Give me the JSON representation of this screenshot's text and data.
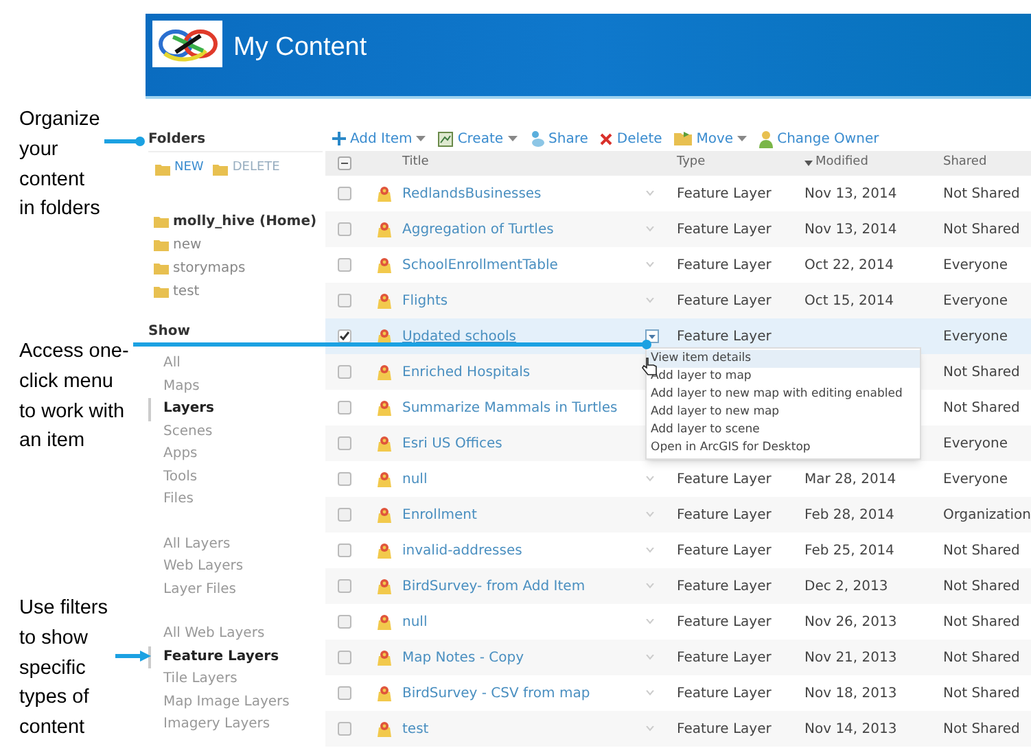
{
  "annotations": [
    {
      "text": "Organize your content in folders"
    },
    {
      "text": "Access one-click menu to work with an item"
    },
    {
      "text": "Use filters to show specific types of content"
    }
  ],
  "header": {
    "title": "My Content"
  },
  "sidebar": {
    "folders_heading": "Folders",
    "folder_actions": [
      {
        "label": "NEW",
        "disabled": false
      },
      {
        "label": "DELETE",
        "disabled": true
      }
    ],
    "folders": [
      {
        "label": "molly_hive (Home)",
        "selected": true
      },
      {
        "label": "new",
        "selected": false
      },
      {
        "label": "storymaps",
        "selected": false
      },
      {
        "label": "test",
        "selected": false
      }
    ],
    "show_heading": "Show",
    "filter_groups": [
      [
        {
          "label": "All",
          "selected": false
        },
        {
          "label": "Maps",
          "selected": false
        },
        {
          "label": "Layers",
          "selected": true
        },
        {
          "label": "Scenes",
          "selected": false
        },
        {
          "label": "Apps",
          "selected": false
        },
        {
          "label": "Tools",
          "selected": false
        },
        {
          "label": "Files",
          "selected": false
        }
      ],
      [
        {
          "label": "All Layers",
          "selected": false
        },
        {
          "label": "Web Layers",
          "selected": false
        },
        {
          "label": "Layer Files",
          "selected": false
        }
      ],
      [
        {
          "label": "All Web Layers",
          "selected": false
        },
        {
          "label": "Feature Layers",
          "selected": true
        },
        {
          "label": "Tile Layers",
          "selected": false
        },
        {
          "label": "Map Image Layers",
          "selected": false
        },
        {
          "label": "Imagery Layers",
          "selected": false
        }
      ]
    ]
  },
  "toolbar": [
    {
      "kind": "add",
      "label": "Add Item",
      "dropdown": true
    },
    {
      "kind": "create",
      "label": "Create",
      "dropdown": true
    },
    {
      "kind": "share",
      "label": "Share",
      "dropdown": false
    },
    {
      "kind": "delete",
      "label": "Delete",
      "dropdown": false
    },
    {
      "kind": "move",
      "label": "Move",
      "dropdown": true
    },
    {
      "kind": "owner",
      "label": "Change Owner",
      "dropdown": false
    }
  ],
  "table": {
    "select_all_indeterminate": true,
    "columns": [
      {
        "label": "Title",
        "sorted": false
      },
      {
        "label": "Type",
        "sorted": false
      },
      {
        "label": "Modified",
        "sorted": true
      },
      {
        "label": "Shared",
        "sorted": false
      }
    ],
    "rows": [
      {
        "checked": false,
        "title": "RedlandsBusinesses",
        "type": "Feature Layer",
        "modified": "Nov 13, 2014",
        "shared": "Not Shared"
      },
      {
        "checked": false,
        "title": "Aggregation of Turtles",
        "type": "Feature Layer",
        "modified": "Nov 13, 2014",
        "shared": "Not Shared"
      },
      {
        "checked": false,
        "title": "SchoolEnrollmentTable",
        "type": "Feature Layer",
        "modified": "Oct 22, 2014",
        "shared": "Everyone"
      },
      {
        "checked": false,
        "title": "Flights",
        "type": "Feature Layer",
        "modified": "Oct 15, 2014",
        "shared": "Everyone"
      },
      {
        "checked": true,
        "title": "Updated schools",
        "type": "Feature Layer",
        "shared": "Everyone",
        "menu_open": true
      },
      {
        "checked": false,
        "title": "Enriched Hospitals",
        "shared": "Not Shared"
      },
      {
        "checked": false,
        "title": "Summarize Mammals in Turtles",
        "shared": "Not Shared"
      },
      {
        "checked": false,
        "title": "Esri US Offices",
        "shared": "Everyone"
      },
      {
        "checked": false,
        "title": "null",
        "type": "Feature Layer",
        "modified": "Mar 28, 2014",
        "shared": "Everyone"
      },
      {
        "checked": false,
        "title": "Enrollment",
        "type": "Feature Layer",
        "modified": "Feb 28, 2014",
        "shared": "Organization"
      },
      {
        "checked": false,
        "title": "invalid-addresses",
        "type": "Feature Layer",
        "modified": "Feb 25, 2014",
        "shared": "Not Shared"
      },
      {
        "checked": false,
        "title": "BirdSurvey- from Add Item",
        "type": "Feature Layer",
        "modified": "Dec 2, 2013",
        "shared": "Not Shared"
      },
      {
        "checked": false,
        "title": "null",
        "type": "Feature Layer",
        "modified": "Nov 26, 2013",
        "shared": "Not Shared"
      },
      {
        "checked": false,
        "title": "Map Notes - Copy",
        "type": "Feature Layer",
        "modified": "Nov 21, 2013",
        "shared": "Not Shared"
      },
      {
        "checked": false,
        "title": "BirdSurvey - CSV from map",
        "type": "Feature Layer",
        "modified": "Nov 18, 2013",
        "shared": "Not Shared"
      },
      {
        "checked": false,
        "title": "test",
        "type": "Feature Layer",
        "modified": "Nov 14, 2013",
        "shared": "Not Shared"
      }
    ]
  },
  "item_menu": {
    "items": [
      {
        "label": "View item details",
        "selected": true
      },
      {
        "label": "Add layer to map",
        "selected": false
      },
      {
        "label": "Add layer to new map with editing enabled",
        "selected": false
      },
      {
        "label": "Add layer to new map",
        "selected": false
      },
      {
        "label": "Add layer to scene",
        "selected": false
      },
      {
        "label": "Open in ArcGIS for Desktop",
        "selected": false
      }
    ]
  }
}
